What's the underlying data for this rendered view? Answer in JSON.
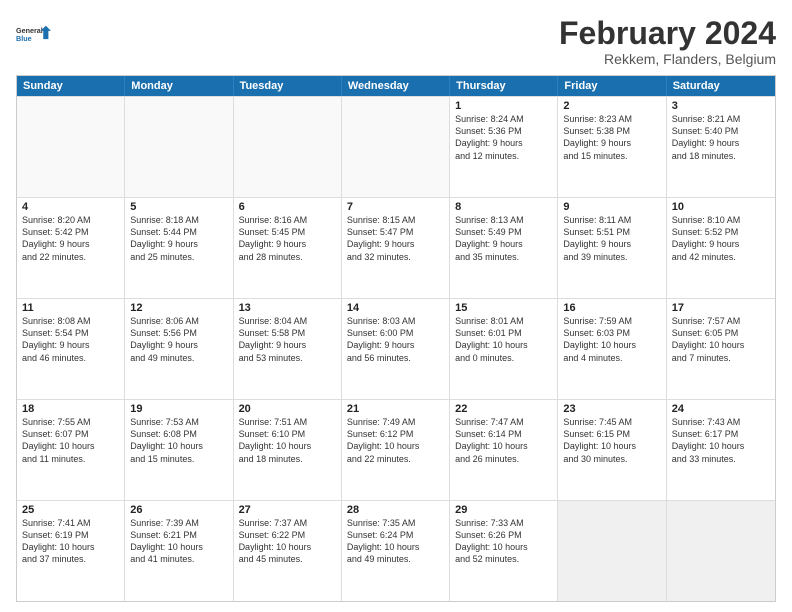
{
  "logo": {
    "line1": "General",
    "line2": "Blue"
  },
  "title": "February 2024",
  "subtitle": "Rekkem, Flanders, Belgium",
  "header_days": [
    "Sunday",
    "Monday",
    "Tuesday",
    "Wednesday",
    "Thursday",
    "Friday",
    "Saturday"
  ],
  "weeks": [
    [
      {
        "day": "",
        "info": ""
      },
      {
        "day": "",
        "info": ""
      },
      {
        "day": "",
        "info": ""
      },
      {
        "day": "",
        "info": ""
      },
      {
        "day": "1",
        "info": "Sunrise: 8:24 AM\nSunset: 5:36 PM\nDaylight: 9 hours\nand 12 minutes."
      },
      {
        "day": "2",
        "info": "Sunrise: 8:23 AM\nSunset: 5:38 PM\nDaylight: 9 hours\nand 15 minutes."
      },
      {
        "day": "3",
        "info": "Sunrise: 8:21 AM\nSunset: 5:40 PM\nDaylight: 9 hours\nand 18 minutes."
      }
    ],
    [
      {
        "day": "4",
        "info": "Sunrise: 8:20 AM\nSunset: 5:42 PM\nDaylight: 9 hours\nand 22 minutes."
      },
      {
        "day": "5",
        "info": "Sunrise: 8:18 AM\nSunset: 5:44 PM\nDaylight: 9 hours\nand 25 minutes."
      },
      {
        "day": "6",
        "info": "Sunrise: 8:16 AM\nSunset: 5:45 PM\nDaylight: 9 hours\nand 28 minutes."
      },
      {
        "day": "7",
        "info": "Sunrise: 8:15 AM\nSunset: 5:47 PM\nDaylight: 9 hours\nand 32 minutes."
      },
      {
        "day": "8",
        "info": "Sunrise: 8:13 AM\nSunset: 5:49 PM\nDaylight: 9 hours\nand 35 minutes."
      },
      {
        "day": "9",
        "info": "Sunrise: 8:11 AM\nSunset: 5:51 PM\nDaylight: 9 hours\nand 39 minutes."
      },
      {
        "day": "10",
        "info": "Sunrise: 8:10 AM\nSunset: 5:52 PM\nDaylight: 9 hours\nand 42 minutes."
      }
    ],
    [
      {
        "day": "11",
        "info": "Sunrise: 8:08 AM\nSunset: 5:54 PM\nDaylight: 9 hours\nand 46 minutes."
      },
      {
        "day": "12",
        "info": "Sunrise: 8:06 AM\nSunset: 5:56 PM\nDaylight: 9 hours\nand 49 minutes."
      },
      {
        "day": "13",
        "info": "Sunrise: 8:04 AM\nSunset: 5:58 PM\nDaylight: 9 hours\nand 53 minutes."
      },
      {
        "day": "14",
        "info": "Sunrise: 8:03 AM\nSunset: 6:00 PM\nDaylight: 9 hours\nand 56 minutes."
      },
      {
        "day": "15",
        "info": "Sunrise: 8:01 AM\nSunset: 6:01 PM\nDaylight: 10 hours\nand 0 minutes."
      },
      {
        "day": "16",
        "info": "Sunrise: 7:59 AM\nSunset: 6:03 PM\nDaylight: 10 hours\nand 4 minutes."
      },
      {
        "day": "17",
        "info": "Sunrise: 7:57 AM\nSunset: 6:05 PM\nDaylight: 10 hours\nand 7 minutes."
      }
    ],
    [
      {
        "day": "18",
        "info": "Sunrise: 7:55 AM\nSunset: 6:07 PM\nDaylight: 10 hours\nand 11 minutes."
      },
      {
        "day": "19",
        "info": "Sunrise: 7:53 AM\nSunset: 6:08 PM\nDaylight: 10 hours\nand 15 minutes."
      },
      {
        "day": "20",
        "info": "Sunrise: 7:51 AM\nSunset: 6:10 PM\nDaylight: 10 hours\nand 18 minutes."
      },
      {
        "day": "21",
        "info": "Sunrise: 7:49 AM\nSunset: 6:12 PM\nDaylight: 10 hours\nand 22 minutes."
      },
      {
        "day": "22",
        "info": "Sunrise: 7:47 AM\nSunset: 6:14 PM\nDaylight: 10 hours\nand 26 minutes."
      },
      {
        "day": "23",
        "info": "Sunrise: 7:45 AM\nSunset: 6:15 PM\nDaylight: 10 hours\nand 30 minutes."
      },
      {
        "day": "24",
        "info": "Sunrise: 7:43 AM\nSunset: 6:17 PM\nDaylight: 10 hours\nand 33 minutes."
      }
    ],
    [
      {
        "day": "25",
        "info": "Sunrise: 7:41 AM\nSunset: 6:19 PM\nDaylight: 10 hours\nand 37 minutes."
      },
      {
        "day": "26",
        "info": "Sunrise: 7:39 AM\nSunset: 6:21 PM\nDaylight: 10 hours\nand 41 minutes."
      },
      {
        "day": "27",
        "info": "Sunrise: 7:37 AM\nSunset: 6:22 PM\nDaylight: 10 hours\nand 45 minutes."
      },
      {
        "day": "28",
        "info": "Sunrise: 7:35 AM\nSunset: 6:24 PM\nDaylight: 10 hours\nand 49 minutes."
      },
      {
        "day": "29",
        "info": "Sunrise: 7:33 AM\nSunset: 6:26 PM\nDaylight: 10 hours\nand 52 minutes."
      },
      {
        "day": "",
        "info": ""
      },
      {
        "day": "",
        "info": ""
      }
    ]
  ]
}
